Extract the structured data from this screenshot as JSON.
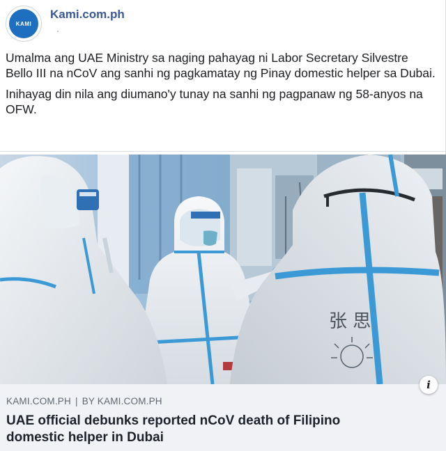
{
  "header": {
    "page_name": "Kami.com.ph",
    "avatar_text": "KAMI"
  },
  "post": {
    "paragraphs": [
      "Umalma ang UAE Ministry sa naging pahayag ni Labor Secretary Silvestre Bello III na nCoV ang sanhi ng pagkamatay ng Pinay domestic helper sa Dubai.",
      "Inihayag din nila ang diumano'y tunay na sanhi ng pagpanaw ng 58-anyos na OFW."
    ]
  },
  "link_preview": {
    "domain": "KAMI.COM.PH",
    "separator": "|",
    "byline": "BY KAMI.COM.PH",
    "title": "UAE official debunks reported nCoV death of Filipino domestic helper in Dubai",
    "info_icon": "info-icon",
    "photo_inscription": "张 思"
  },
  "colors": {
    "brand_blue": "#385898",
    "avatar_blue": "#1f6fc0",
    "link_box_bg": "#f0f2f5",
    "tape_blue": "#3b9ad6"
  }
}
